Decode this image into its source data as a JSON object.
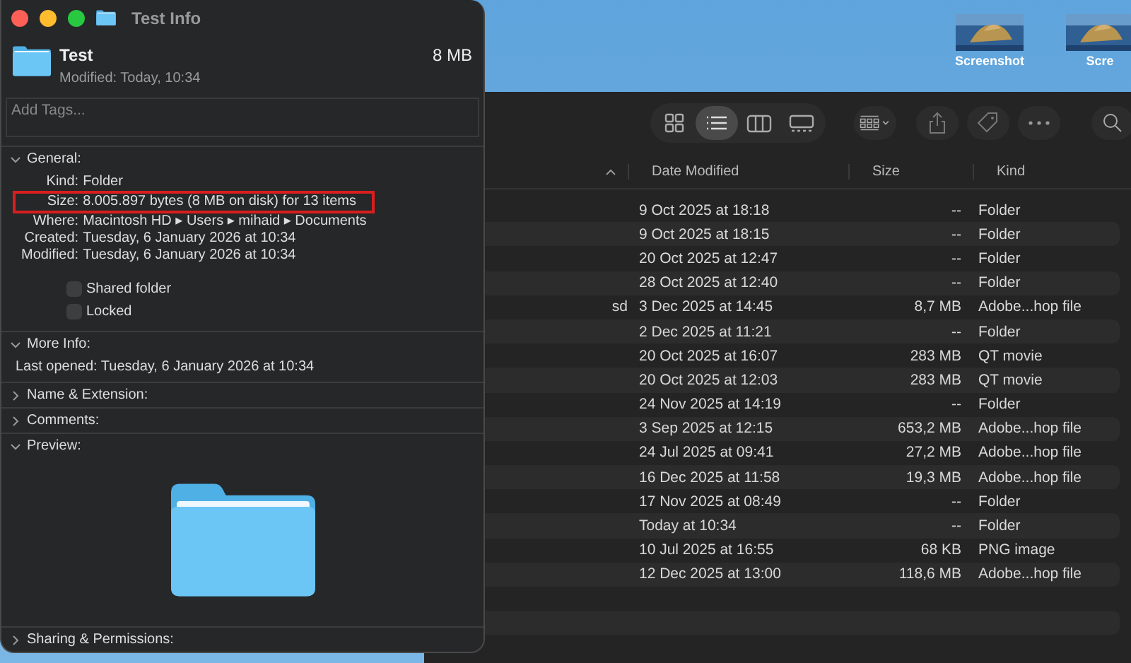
{
  "desktop": {
    "icons": [
      {
        "label": "Screenshot",
        "kind": "picture"
      },
      {
        "label": "Scre",
        "kind": "picture"
      }
    ]
  },
  "info_window": {
    "title": "Test Info",
    "name": "Test",
    "size": "8 MB",
    "modified": "Modified: Today, 10:34",
    "tags_placeholder": "Add Tags...",
    "sections": [
      {
        "title": "General:",
        "expanded": true,
        "kind": "general",
        "rows": [
          {
            "label": "Kind:",
            "value": "Folder",
            "highlighted": false
          },
          {
            "label": "Size:",
            "value": "8.005.897 bytes (8 MB on disk) for 13 items",
            "highlighted": true
          },
          {
            "label": "Where:",
            "value": "Macintosh HD ▸ Users ▸ mihaid ▸ Documents",
            "highlighted": false
          },
          {
            "label": "Created:",
            "value": "Tuesday, 6 January 2026 at 10:34",
            "highlighted": false
          },
          {
            "label": "Modified:",
            "value": "Tuesday, 6 January 2026 at 10:34",
            "highlighted": false
          }
        ],
        "checkboxes": [
          {
            "label": "Shared folder",
            "checked": false
          },
          {
            "label": "Locked",
            "checked": false
          }
        ]
      },
      {
        "title": "More Info:",
        "expanded": true,
        "kind": "text",
        "text": "Last opened: Tuesday, 6 January 2026 at 10:34"
      },
      {
        "title": "Name & Extension:",
        "expanded": false,
        "kind": "text"
      },
      {
        "title": "Comments:",
        "expanded": false,
        "kind": "text"
      },
      {
        "title": "Preview:",
        "expanded": true,
        "kind": "preview"
      },
      {
        "title": "Sharing & Permissions:",
        "expanded": false,
        "kind": "text"
      }
    ]
  },
  "finder": {
    "toolbar": {
      "views": [
        {
          "kind": "icons",
          "selected": false
        },
        {
          "kind": "list",
          "selected": true
        },
        {
          "kind": "columns",
          "selected": false
        },
        {
          "kind": "gallery",
          "selected": false
        }
      ]
    },
    "columns": [
      "Date Modified",
      "Size",
      "Kind"
    ],
    "rows": [
      {
        "name": "",
        "date": "9 Oct 2025 at 18:18",
        "size": "--",
        "kind": "Folder"
      },
      {
        "name": "",
        "date": "9 Oct 2025 at 18:15",
        "size": "--",
        "kind": "Folder"
      },
      {
        "name": "",
        "date": "20 Oct 2025 at 12:47",
        "size": "--",
        "kind": "Folder"
      },
      {
        "name": "",
        "date": "28 Oct 2025 at 12:40",
        "size": "--",
        "kind": "Folder"
      },
      {
        "name": "sd",
        "date": "3 Dec 2025 at 14:45",
        "size": "8,7 MB",
        "kind": "Adobe...hop file"
      },
      {
        "name": "",
        "date": "2 Dec 2025 at 11:21",
        "size": "--",
        "kind": "Folder"
      },
      {
        "name": "",
        "date": "20 Oct 2025 at 16:07",
        "size": "283 MB",
        "kind": "QT movie"
      },
      {
        "name": "",
        "date": "20 Oct 2025 at 12:03",
        "size": "283 MB",
        "kind": "QT movie"
      },
      {
        "name": "",
        "date": "24 Nov 2025 at 14:19",
        "size": "--",
        "kind": "Folder"
      },
      {
        "name": "",
        "date": "3 Sep 2025 at 12:15",
        "size": "653,2 MB",
        "kind": "Adobe...hop file"
      },
      {
        "name": "",
        "date": "24 Jul 2025 at 09:41",
        "size": "27,2 MB",
        "kind": "Adobe...hop file"
      },
      {
        "name": "",
        "date": "16 Dec 2025 at 11:58",
        "size": "19,3 MB",
        "kind": "Adobe...hop file"
      },
      {
        "name": "",
        "date": "17 Nov 2025 at 08:49",
        "size": "--",
        "kind": "Folder"
      },
      {
        "name": "",
        "date": "Today at 10:34",
        "size": "--",
        "kind": "Folder"
      },
      {
        "name": "",
        "date": "10 Jul 2025 at 16:55",
        "size": "68 KB",
        "kind": "PNG image"
      },
      {
        "name": "",
        "date": "12 Dec 2025 at 13:00",
        "size": "118,6 MB",
        "kind": "Adobe...hop file"
      }
    ]
  }
}
